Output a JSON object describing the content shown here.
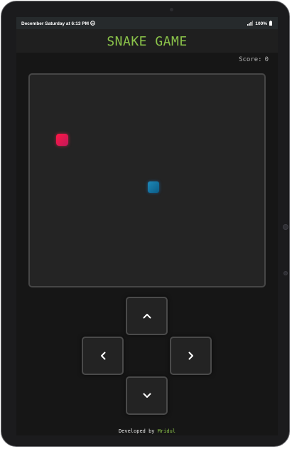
{
  "status_bar": {
    "left_text": "December Saturday at 6:13 PM",
    "battery": "100%",
    "icons": [
      "do-not-disturb-icon",
      "signal-icon",
      "battery-icon"
    ]
  },
  "header": {
    "title": "SNAKE GAME"
  },
  "score": {
    "label": "Score:",
    "value": "0"
  },
  "controls": {
    "up": "up-arrow",
    "left": "left-arrow",
    "right": "right-arrow",
    "down": "down-arrow"
  },
  "footer": {
    "prefix": "Developed by",
    "author": "Mridul"
  },
  "colors": {
    "accent": "#8bc34a",
    "food": "#ff1744",
    "snake": "#1e88b8",
    "board": "#242424",
    "background": "#161616"
  }
}
